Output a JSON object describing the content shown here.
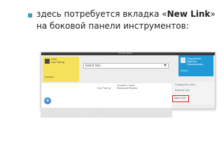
{
  "slide": {
    "text_part1": "здесь потребуется вкладка «",
    "text_bold": "New Link",
    "text_part2": "» на боковой панели инструментов:"
  },
  "screenshot": {
    "window_title": "Clarity Client",
    "yellow_card": {
      "line1": "ООО",
      "line2": "Где Тренд",
      "footer": "Updated"
    },
    "select_placeholder": "Select One",
    "blue_card": {
      "name_line1": "Подробнее",
      "name_line2": "Марина",
      "name_line3": "Пряжникова",
      "footer": "Details"
    },
    "middle_labels": {
      "left": "Где Тренд",
      "right_line1": "Создать тема",
      "right_line2": "Ведущий Видео"
    },
    "side_panel": {
      "item1": "Categories Links",
      "item2": "Expand Link",
      "item3": "New Link"
    },
    "add_button": "+"
  },
  "colors": {
    "bullet": "#3aa0b8",
    "yellow_card": "#f6e25a",
    "blue_card": "#1f9ad6",
    "highlight_border": "#d62a2a",
    "add_button": "#3d8ed8"
  }
}
